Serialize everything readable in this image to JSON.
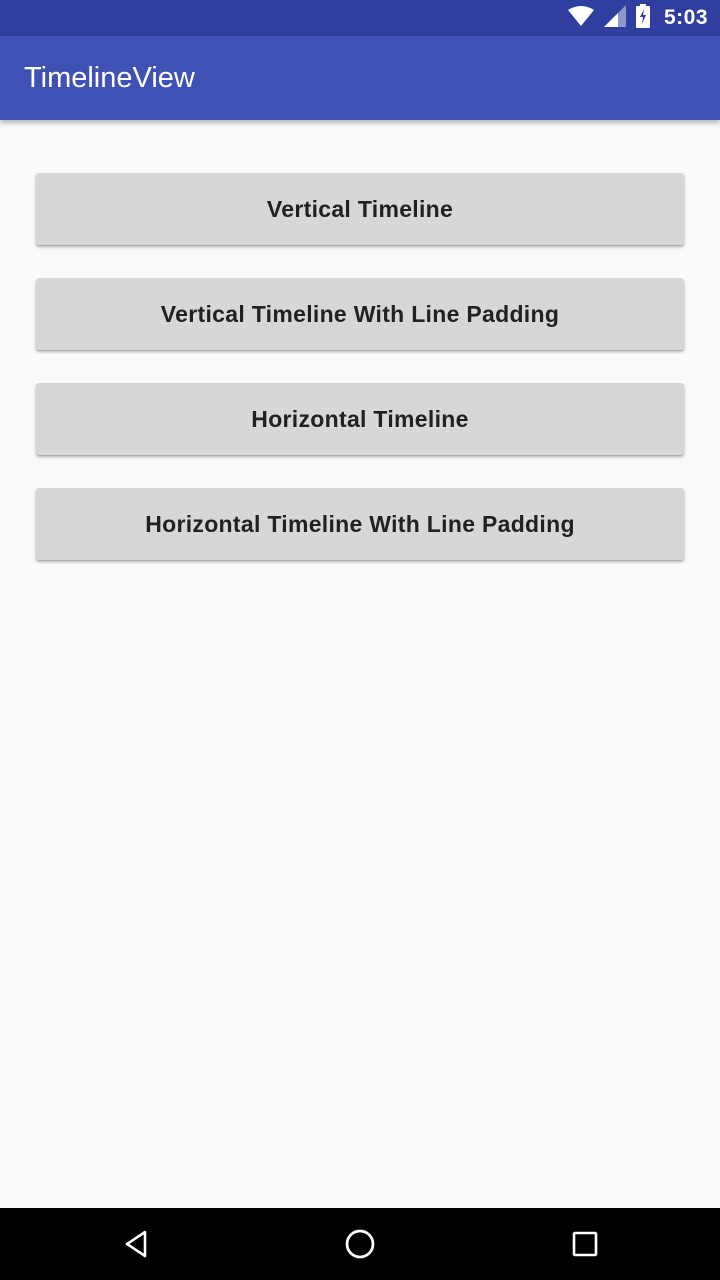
{
  "status_bar": {
    "time": "5:03",
    "icons": [
      "wifi-icon",
      "cell-signal-icon",
      "battery-icon"
    ]
  },
  "app_bar": {
    "title": "TimelineView"
  },
  "buttons": [
    {
      "label": "Vertical Timeline"
    },
    {
      "label": "Vertical Timeline With Line Padding"
    },
    {
      "label": "Horizontal Timeline"
    },
    {
      "label": "Horizontal Timeline With Line Padding"
    }
  ],
  "nav_bar": {
    "icons": [
      "back-icon",
      "home-icon",
      "recents-icon"
    ]
  },
  "colors": {
    "status_bar": "#303f9f",
    "app_bar": "#3f51b5",
    "background": "#fafafa",
    "button": "#d6d7d7",
    "button_text": "#212121"
  }
}
